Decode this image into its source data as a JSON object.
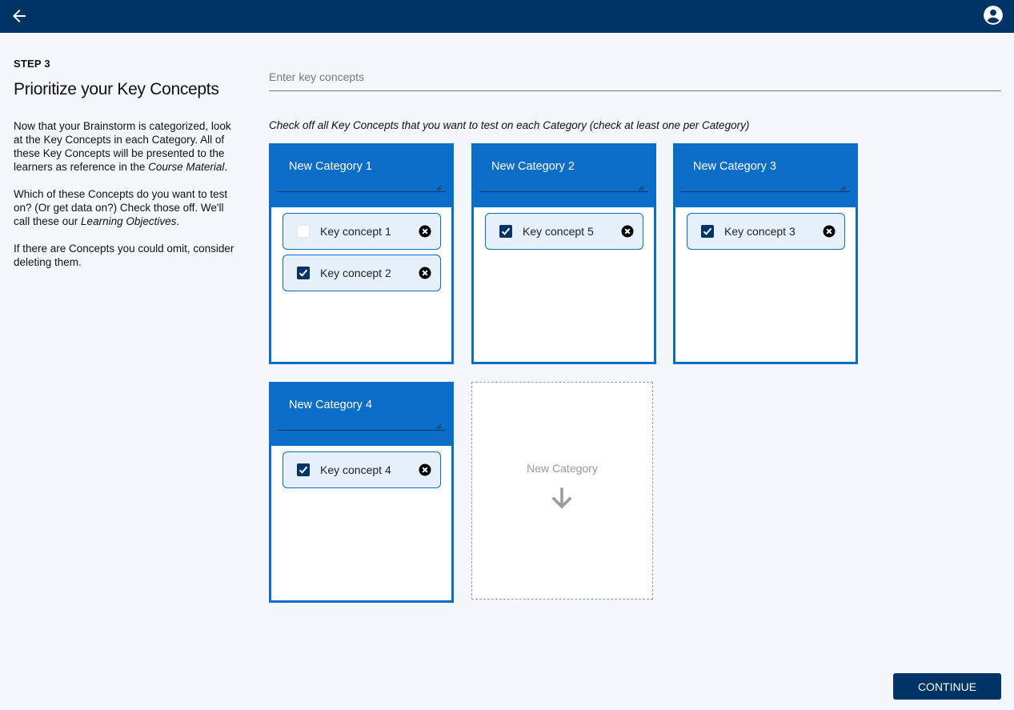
{
  "header": {
    "back_icon": "back-arrow-icon",
    "user_icon": "account-circle-icon"
  },
  "sidebar": {
    "step": "STEP 3",
    "title": "Prioritize your Key Concepts",
    "para1_text": "Now that your Brainstorm is categorized, look at the Key Concepts in each Category. All of these Key Concepts will be presented to the learners as reference in the ",
    "para1_em": "Course Material",
    "para1_end": ".",
    "para2_text": "Which of these Concepts do you want to test on? (Or get data on?) Check those off. We'll call these our ",
    "para2_em": "Learning Objectives",
    "para2_end": ".",
    "para3": "If there are Concepts you could omit, consider deleting them."
  },
  "concept_input": {
    "placeholder": "Enter key concepts",
    "value": ""
  },
  "instructions": "Check off all Key Concepts that you want to test on each Category (check at least one per Category)",
  "categories": [
    {
      "name": "New Category 1",
      "concepts": [
        {
          "label": "Key concept 1",
          "checked": false
        },
        {
          "label": "Key concept 2",
          "checked": true
        }
      ]
    },
    {
      "name": "New Category 2",
      "concepts": [
        {
          "label": "Key concept 5",
          "checked": true
        }
      ]
    },
    {
      "name": "New Category 3",
      "concepts": [
        {
          "label": "Key concept 3",
          "checked": true
        }
      ]
    },
    {
      "name": "New Category 4",
      "concepts": [
        {
          "label": "Key concept 4",
          "checked": true
        }
      ]
    }
  ],
  "new_category": {
    "label": "New Category",
    "icon": "arrow-down-icon"
  },
  "continue_label": "CONTINUE",
  "colors": {
    "topbar": "#003366",
    "accent": "#0a6ec8",
    "chip_bg": "#e6f0fa",
    "page_bg": "#f3f6fb"
  }
}
